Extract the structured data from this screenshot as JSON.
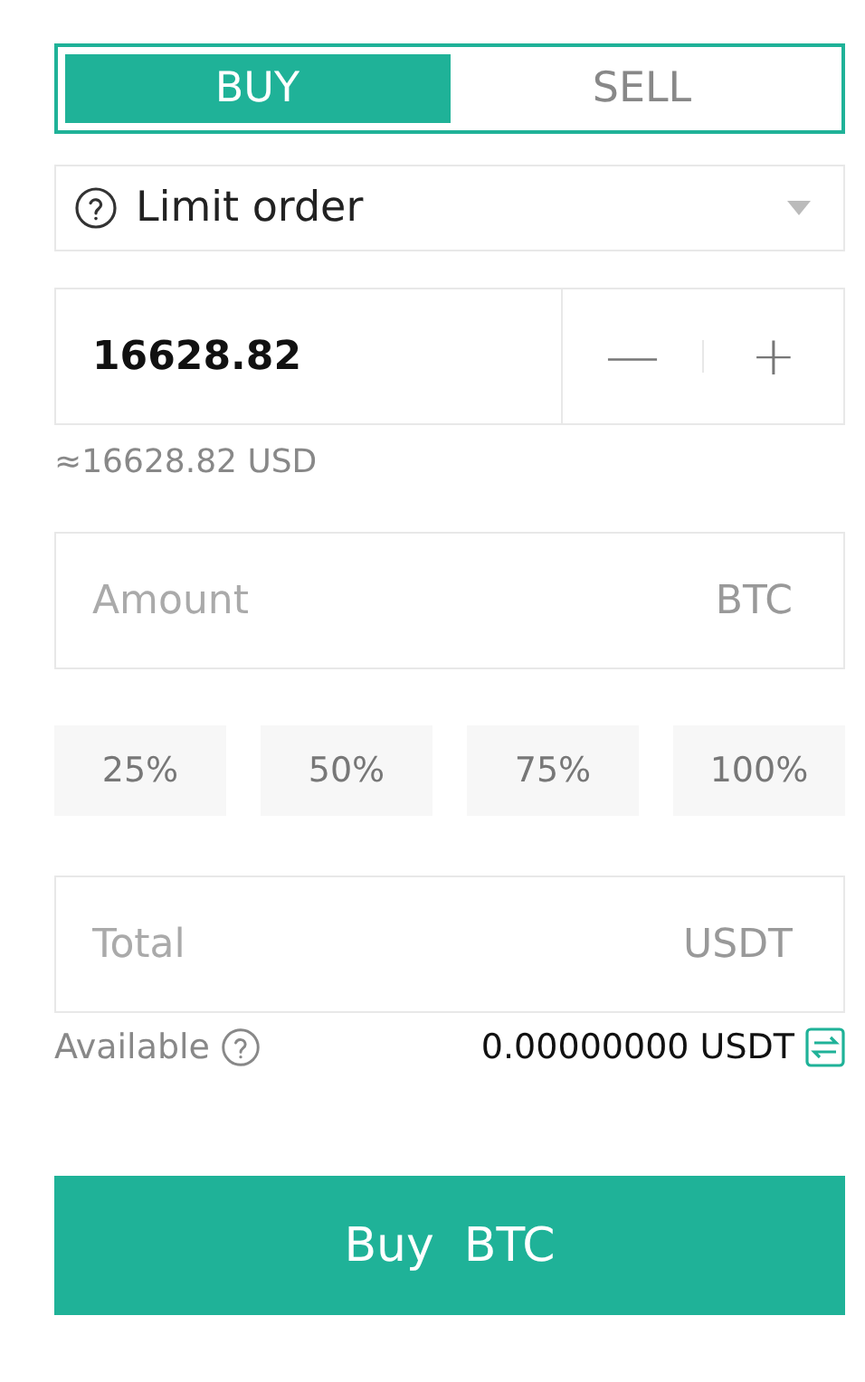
{
  "side_tabs": [
    {
      "label": "BUY",
      "selected": true
    },
    {
      "label": "SELL",
      "selected": false
    }
  ],
  "order_type": {
    "label": "Limit order"
  },
  "price": {
    "value": "16628.82",
    "decrement": "—",
    "increment": "+"
  },
  "price_estimate": "≈16628.82 USD",
  "amount": {
    "placeholder": "Amount",
    "unit": "BTC"
  },
  "percent_buttons": [
    "25%",
    "50%",
    "75%",
    "100%"
  ],
  "total": {
    "placeholder": "Total",
    "unit": "USDT"
  },
  "available": {
    "label": "Available",
    "value": "0.00000000 USDT"
  },
  "submit": {
    "label": "Buy  BTC"
  }
}
